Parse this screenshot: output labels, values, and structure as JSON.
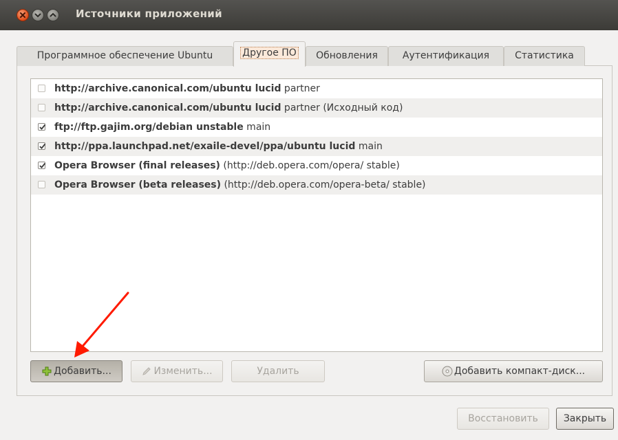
{
  "window": {
    "title": "Источники приложений"
  },
  "tabs": [
    {
      "label": "Программное обеспечение Ubuntu"
    },
    {
      "label": "Другое ПО"
    },
    {
      "label": "Обновления"
    },
    {
      "label": "Аутентификация"
    },
    {
      "label": "Статистика"
    }
  ],
  "sources": [
    {
      "checked": false,
      "bold": "http://archive.canonical.com/ubuntu lucid",
      "rest": " partner"
    },
    {
      "checked": false,
      "bold": "http://archive.canonical.com/ubuntu lucid",
      "rest": " partner (Исходный код)"
    },
    {
      "checked": true,
      "bold": "ftp://ftp.gajim.org/debian unstable",
      "rest": " main"
    },
    {
      "checked": true,
      "bold": "http://ppa.launchpad.net/exaile-devel/ppa/ubuntu lucid",
      "rest": " main"
    },
    {
      "checked": true,
      "bold": "Opera Browser (final releases)",
      "rest": " (http://deb.opera.com/opera/ stable)"
    },
    {
      "checked": false,
      "bold": "Opera Browser (beta releases)",
      "rest": " (http://deb.opera.com/opera-beta/ stable)"
    }
  ],
  "buttons": {
    "add": "Добавить...",
    "edit": "Изменить...",
    "remove": "Удалить",
    "add_cd": "Добавить компакт-диск...",
    "revert": "Восстановить",
    "close": "Закрыть"
  },
  "colors": {
    "accent": "#df4a16",
    "titlebar": "#3c3b37",
    "annotation_arrow": "#ff1a00"
  },
  "icons": [
    "close-icon",
    "minimize-icon",
    "maximize-icon",
    "add-icon",
    "edit-pencil-icon",
    "cd-icon"
  ]
}
